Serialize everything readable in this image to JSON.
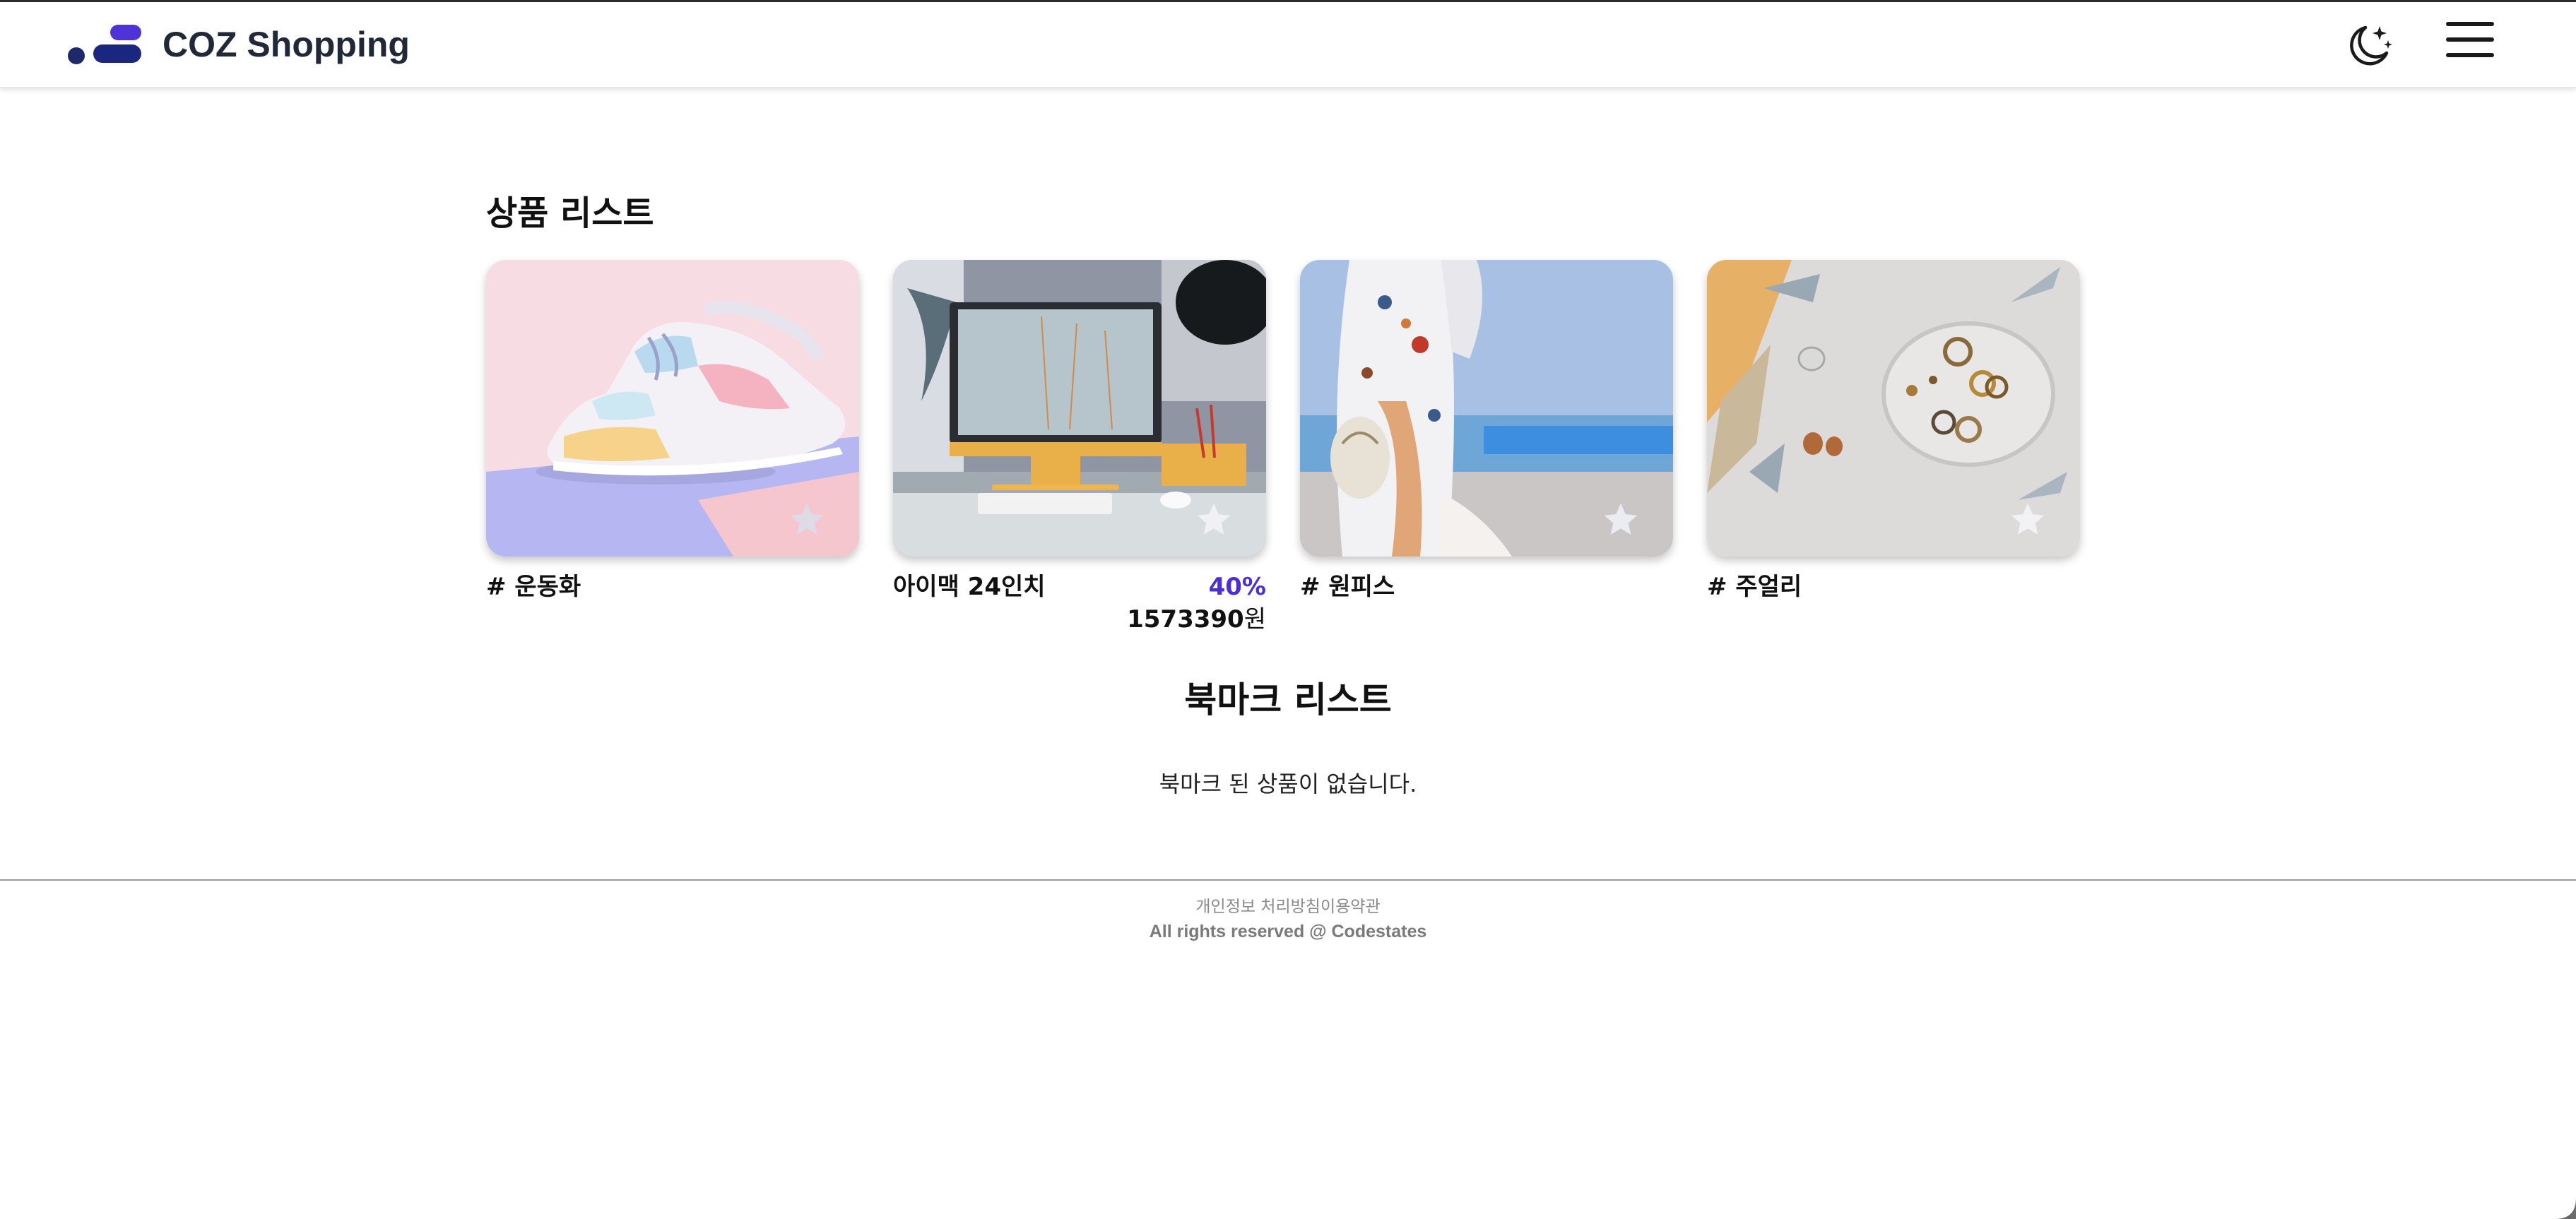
{
  "header": {
    "brand": "COZ Shopping",
    "theme_toggle_icon": "moon-stars-icon",
    "menu_icon": "hamburger-menu-icon"
  },
  "products": {
    "title": "상품 리스트",
    "items": [
      {
        "label": "# 운동화",
        "image": "sneakers",
        "bookmark_icon": "star-icon"
      },
      {
        "label": "아이맥 24인치",
        "discount": "40%",
        "price": "1573390",
        "price_unit": "원",
        "image": "imac-desk",
        "bookmark_icon": "star-icon"
      },
      {
        "label": "# 원피스",
        "image": "floral-dress",
        "bookmark_icon": "star-icon"
      },
      {
        "label": "# 주얼리",
        "image": "rings-tray",
        "bookmark_icon": "star-icon"
      }
    ]
  },
  "bookmarks": {
    "title": "북마크 리스트",
    "empty_message": "북마크 된 상품이 없습니다."
  },
  "footer": {
    "privacy_link": "개인정보 처리방침",
    "terms_link": "이용약관",
    "copyright": "All rights reserved @ Codestates"
  },
  "colors": {
    "accent": "#4a2fd6",
    "logo_dark": "#1a2680",
    "logo_purple": "#4d33d8",
    "brand_text": "#1f2937"
  }
}
